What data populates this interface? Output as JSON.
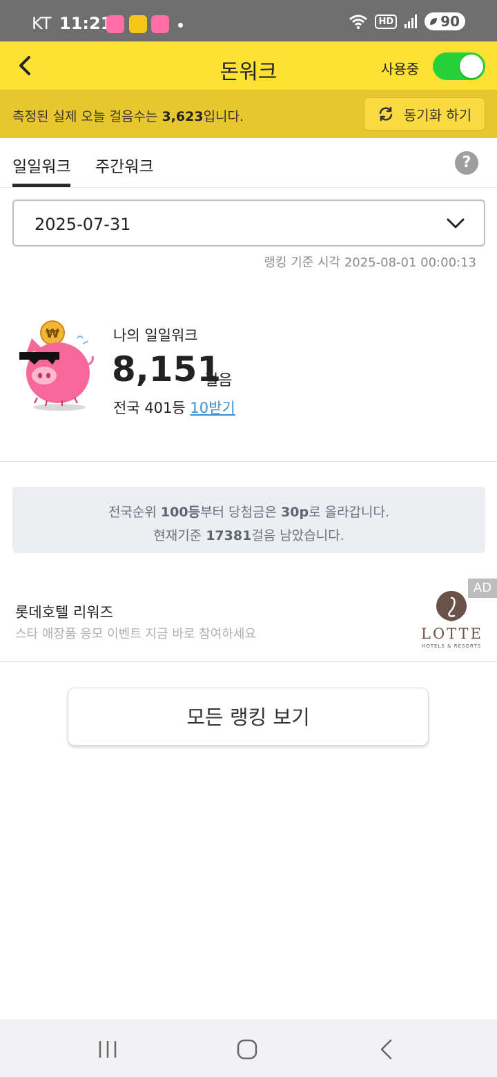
{
  "status_bar": {
    "carrier": "KT",
    "time": "11:21",
    "battery": "90",
    "hd": "HD"
  },
  "header": {
    "title": "돈워크",
    "in_use_label": "사용중",
    "toggle_on": true,
    "accent_color": "#ffe135",
    "toggle_color": "#25d23a"
  },
  "measure": {
    "prefix": "측정된 실제 오늘 걸음수는 ",
    "steps": "3,623",
    "suffix": "입니다.",
    "sync_label": "동기화 하기"
  },
  "tabs": {
    "daily": "일일워크",
    "weekly": "주간워크",
    "active": "daily",
    "help": "?"
  },
  "date_select": {
    "value": "2025-07-31",
    "ranking_time": "랭킹 기준 시각 2025-08-01 00:00:13"
  },
  "my_record": {
    "label": "나의 일일워크",
    "steps": "8,151",
    "unit": "걸음",
    "rank_text": "전국 401등 ",
    "reward_link": "10받기"
  },
  "info_box": {
    "line1_a": "전국순위 ",
    "line1_b": "100등",
    "line1_c": "부터 당첨금은 ",
    "line1_d": "30p",
    "line1_e": "로 올라갑니다.",
    "line2_a": "현재기준 ",
    "line2_b": "17381",
    "line2_c": "걸음 남았습니다."
  },
  "ad": {
    "badge": "AD",
    "title": "롯데호텔 리워즈",
    "description": "스타 애장품 응모 이벤트 지금 바로 참여하세요",
    "logo_word": "LOTTE",
    "logo_sub": "HOTELS & RESORTS"
  },
  "all_ranking_label": "모든 랭킹 보기"
}
